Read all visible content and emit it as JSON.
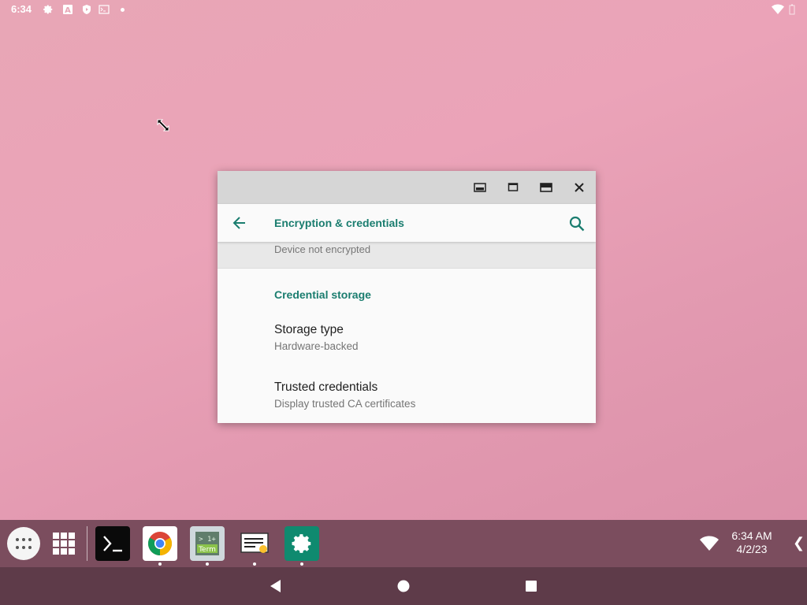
{
  "status_bar": {
    "time": "6:34",
    "icons": [
      "gear-icon",
      "a-badge-icon",
      "shield-play-icon",
      "terminal-mini-icon"
    ],
    "right_icons": [
      "wifi-icon",
      "battery-icon"
    ]
  },
  "window": {
    "caption_buttons": [
      "picture-in-picture-icon",
      "restore-icon",
      "maximize-icon",
      "close-icon"
    ],
    "app_bar": {
      "title": "Encryption & credentials",
      "back_icon": "arrow-left-icon",
      "search_icon": "search-icon"
    },
    "encryption_summary": "Device not encrypted",
    "section_header": "Credential storage",
    "items": [
      {
        "title": "Storage type",
        "summary": "Hardware-backed"
      },
      {
        "title": "Trusted credentials",
        "summary": "Display trusted CA certificates"
      }
    ]
  },
  "taskbar": {
    "apps": [
      {
        "name": "app-drawer",
        "icon": "apps-dots-icon"
      },
      {
        "name": "overview",
        "icon": "grid-icon"
      },
      {
        "name": "terminal",
        "icon": "terminal-icon"
      },
      {
        "name": "chrome",
        "icon": "chrome-icon"
      },
      {
        "name": "term-1plus",
        "icon": "term-icon"
      },
      {
        "name": "notes",
        "icon": "notes-icon"
      },
      {
        "name": "settings",
        "icon": "gear-icon"
      }
    ],
    "term_label_top": "> 1+",
    "term_label_bottom": "Term",
    "clock_time": "6:34 AM",
    "clock_date": "4/2/23"
  },
  "navigation": [
    "back-triangle-icon",
    "home-circle-icon",
    "recents-square-icon"
  ],
  "colors": {
    "accent": "#1a7d6f",
    "taskbar": "#7b4d5e",
    "navbar": "#5e3b49"
  }
}
